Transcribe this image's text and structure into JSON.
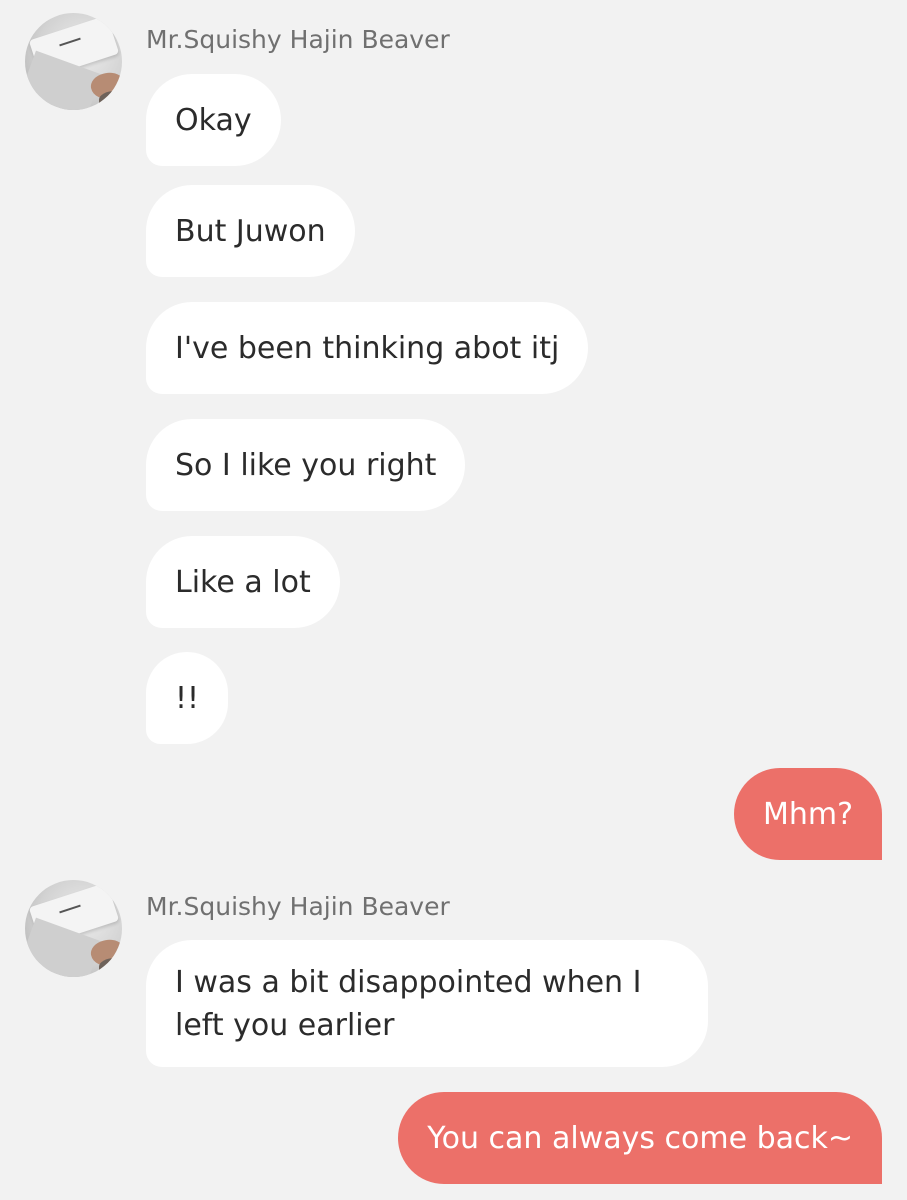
{
  "conversation": {
    "contact_name": "Mr.Squishy Hajin Beaver",
    "messages": [
      {
        "from": "contact",
        "text": "Okay"
      },
      {
        "from": "contact",
        "text": "But Juwon"
      },
      {
        "from": "contact",
        "text": "I've been thinking abot itj"
      },
      {
        "from": "contact",
        "text": "So I like you right"
      },
      {
        "from": "contact",
        "text": "Like a lot"
      },
      {
        "from": "contact",
        "text": "!!"
      },
      {
        "from": "me",
        "text": "Mhm?"
      },
      {
        "from": "contact",
        "text": "I was a bit disappointed when I left you earlier"
      },
      {
        "from": "me",
        "text": "You can always come back~"
      }
    ]
  },
  "colors": {
    "background": "#f2f2f2",
    "incoming_bubble": "#ffffff",
    "outgoing_bubble": "#ec7069",
    "sender_name": "#707070"
  },
  "icons": {
    "avatar": "contact-avatar-photo"
  }
}
